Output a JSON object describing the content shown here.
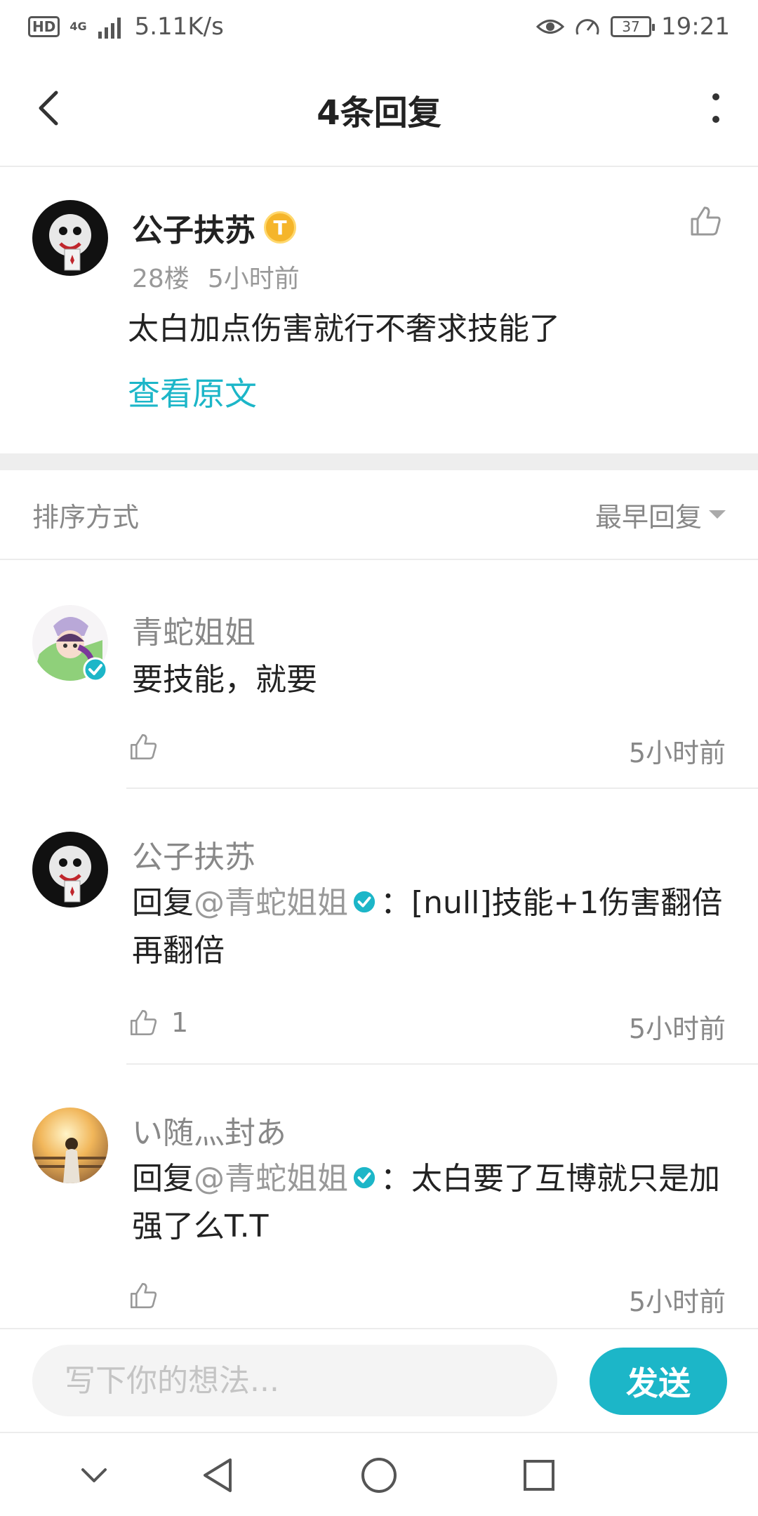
{
  "status_bar": {
    "hd": "HD",
    "network": "4G",
    "speed": "5.11K/s",
    "battery": "37",
    "time": "19:21"
  },
  "header": {
    "title": "4条回复"
  },
  "post": {
    "username": "公子扶苏",
    "level_badge": "T",
    "floor": "28楼",
    "time": "5小时前",
    "content": "太白加点伤害就行不奢求技能了",
    "view_original": "查看原文"
  },
  "sort": {
    "label": "排序方式",
    "value": "最早回复"
  },
  "replies": [
    {
      "username": "青蛇姐姐",
      "content": "要技能，就要",
      "likes": "",
      "time": "5小时前"
    },
    {
      "username": "公子扶苏",
      "reply_prefix": "回复",
      "mention": "@青蛇姐姐",
      "content": "：[null]技能+1伤害翻倍再翻倍",
      "likes": "1",
      "time": "5小时前"
    },
    {
      "username": "い随灬封あ",
      "reply_prefix": "回复",
      "mention": "@青蛇姐姐",
      "content": "：太白要了互博就只是加强了么T.T",
      "likes": "",
      "time": "5小时前"
    }
  ],
  "input": {
    "placeholder": "写下你的想法...",
    "send_label": "发送"
  },
  "colors": {
    "accent": "#1cb6c8",
    "badge_gold": "#f5b52a"
  }
}
